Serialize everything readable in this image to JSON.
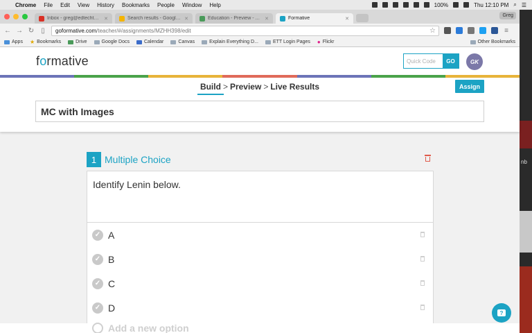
{
  "menubar": {
    "items": [
      "Chrome",
      "File",
      "Edit",
      "View",
      "History",
      "Bookmarks",
      "People",
      "Window",
      "Help"
    ],
    "battery": "100%",
    "clock": "Thu 12:10 PM"
  },
  "tabs": [
    {
      "title": "Inbox - greg@edtechteacher.org",
      "color": "#d93025"
    },
    {
      "title": "Search results - Google Drive",
      "color": "#f4b400"
    },
    {
      "title": "Education - Preview - Assignments",
      "color": "#4a9a5a"
    },
    {
      "title": "Formative",
      "color": "#1ca3c4",
      "active": true
    }
  ],
  "profile": "Greg",
  "url": {
    "host": "goformative.com",
    "path": "/teacher/#/assignments/MZHH398/edit"
  },
  "bookmarks": [
    "Apps",
    "Bookmarks",
    "Drive",
    "Google Docs",
    "Calendar",
    "Canvas",
    "Explain Everything D...",
    "ETT Login Pages",
    "Flickr"
  ],
  "other_bookmarks": "Other Bookmarks",
  "app": {
    "logo_pre": "f",
    "logo_o": "o",
    "logo_post": "rmative",
    "quickcode_placeholder": "Quick Code",
    "go": "GO",
    "avatar": "GK",
    "rainbow": [
      "#6c74b8",
      "#4aa34a",
      "#e8b43a",
      "#e06a5a",
      "#6c74b8",
      "#4aa34a",
      "#e8b43a"
    ]
  },
  "build": {
    "crumbs": [
      "Build",
      "Preview",
      "Live Results"
    ],
    "sep": ">",
    "assign": "Assign",
    "title": "MC with Images"
  },
  "question": {
    "number": "1",
    "type": "Multiple Choice",
    "prompt": "Identify Lenin below.",
    "options": [
      "A",
      "B",
      "C",
      "D"
    ],
    "add_option": "Add a new option"
  }
}
